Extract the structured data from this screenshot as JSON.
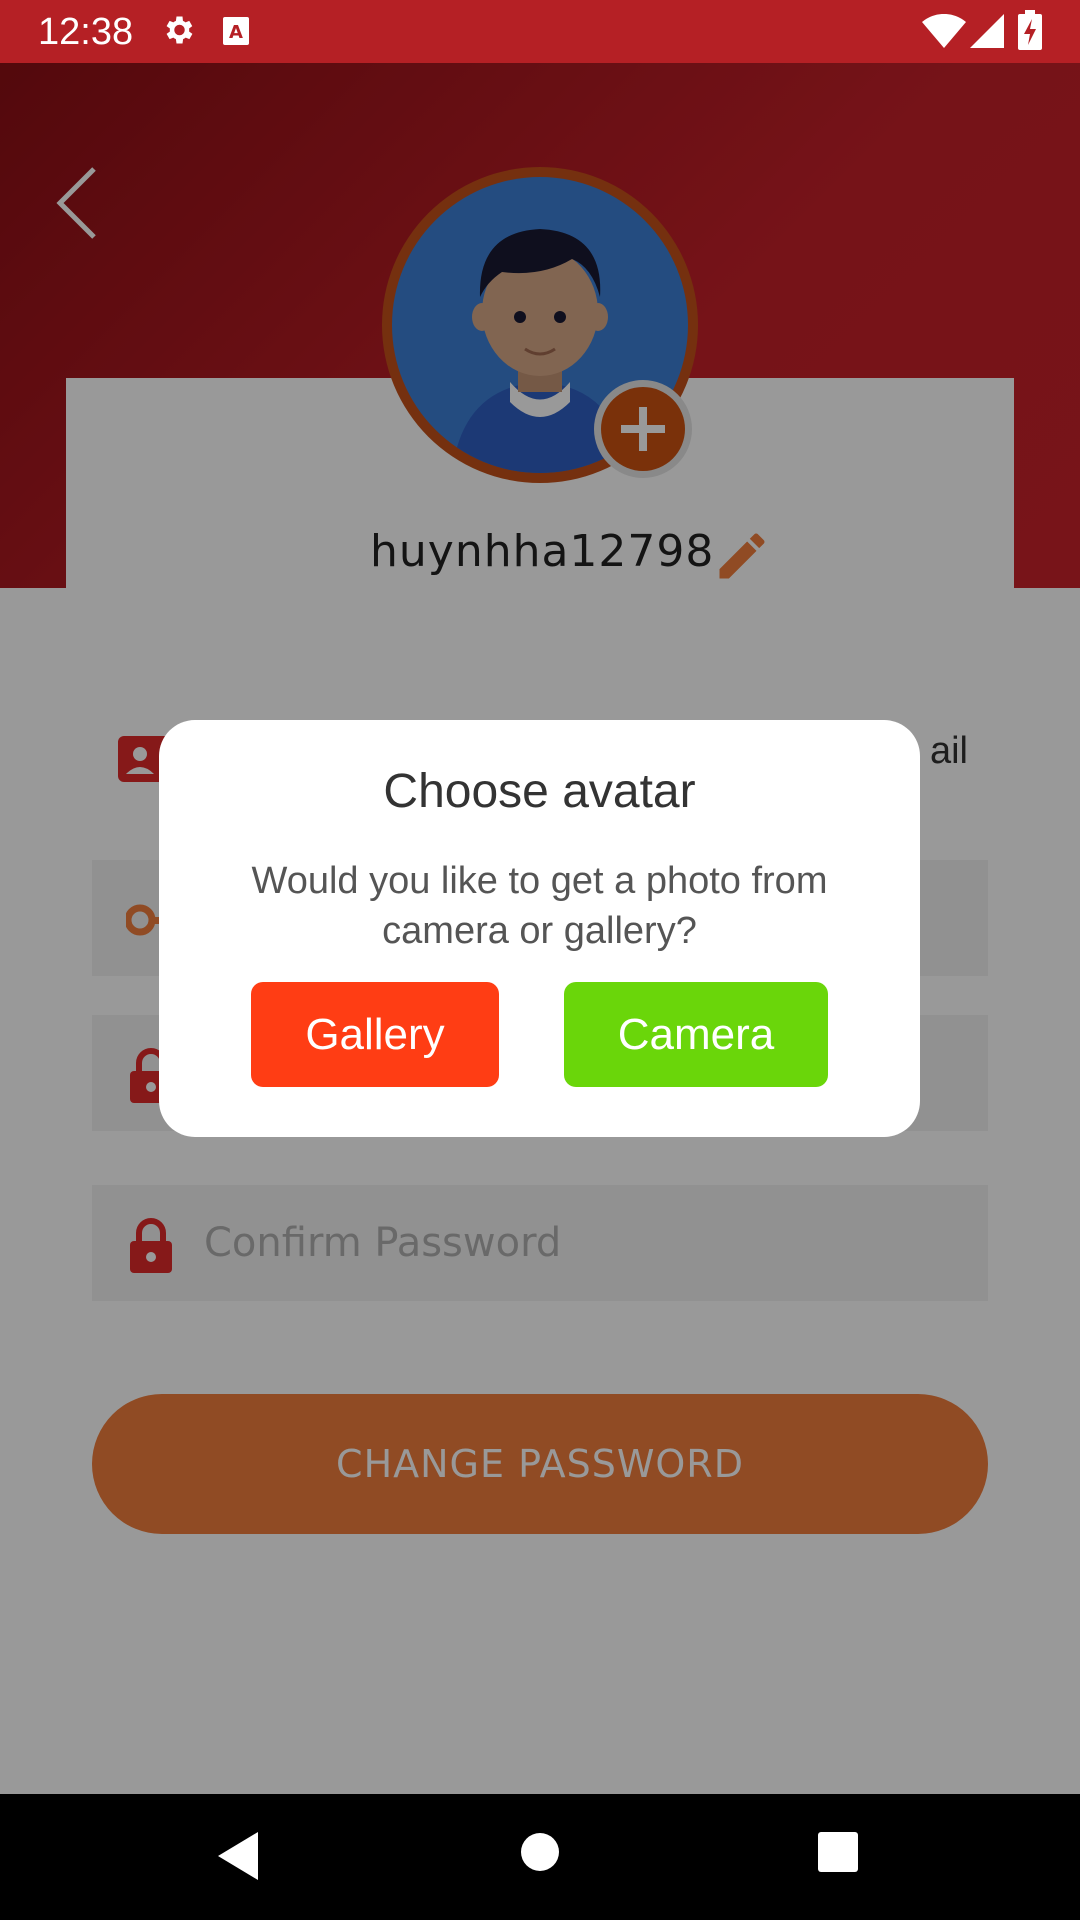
{
  "status_bar": {
    "time": "12:38"
  },
  "header": {
    "username": "huynhha12798"
  },
  "form": {
    "email_label": "ail",
    "confirm_password_placeholder": "Confirm Password",
    "change_password_label": "CHANGE PASSWORD"
  },
  "dialog": {
    "title": "Choose avatar",
    "message": "Would you like to get a photo from camera or gallery?",
    "gallery_label": "Gallery",
    "camera_label": "Camera"
  },
  "colors": {
    "header_red": "#c52029",
    "accent_orange": "#f07d3c",
    "gallery_button": "#ff3d14",
    "camera_button": "#6ad60a"
  }
}
